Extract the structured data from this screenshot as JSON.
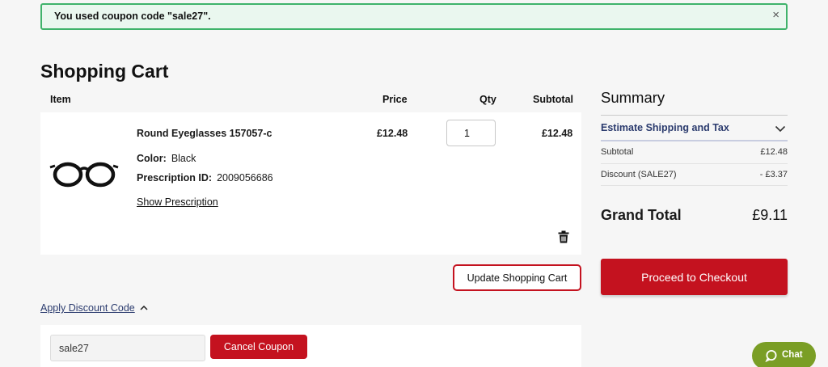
{
  "notice": {
    "message": "You used coupon code \"sale27\".",
    "close": "×"
  },
  "page_title": "Shopping Cart",
  "cart": {
    "columns": {
      "item": "Item",
      "price": "Price",
      "qty": "Qty",
      "subtotal": "Subtotal"
    },
    "item": {
      "name": "Round Eyeglasses 157057-c",
      "color_label": "Color:",
      "color_value": "Black",
      "prescription_label": "Prescription ID:",
      "prescription_value": "2009056686",
      "show_prescription": "Show Prescription",
      "price": "£12.48",
      "qty": "1",
      "subtotal": "£12.48",
      "remove_icon": "trash-icon"
    },
    "update_button": "Update Shopping Cart"
  },
  "discount": {
    "toggle_label": "Apply Discount Code",
    "code_value": "sale27",
    "cancel_button": "Cancel Coupon"
  },
  "summary": {
    "title": "Summary",
    "estimate_label": "Estimate Shipping and Tax",
    "subtotal_label": "Subtotal",
    "subtotal_value": "£12.48",
    "discount_label": "Discount (SALE27)",
    "discount_value": "- £3.37",
    "grand_total_label": "Grand Total",
    "grand_total_value": "£9.11",
    "checkout_button": "Proceed to Checkout"
  },
  "chat": {
    "label": "Chat"
  },
  "colors": {
    "brand_red": "#c4121f",
    "notice_green": "#3fb36b",
    "chat_green": "#7a9e25"
  }
}
